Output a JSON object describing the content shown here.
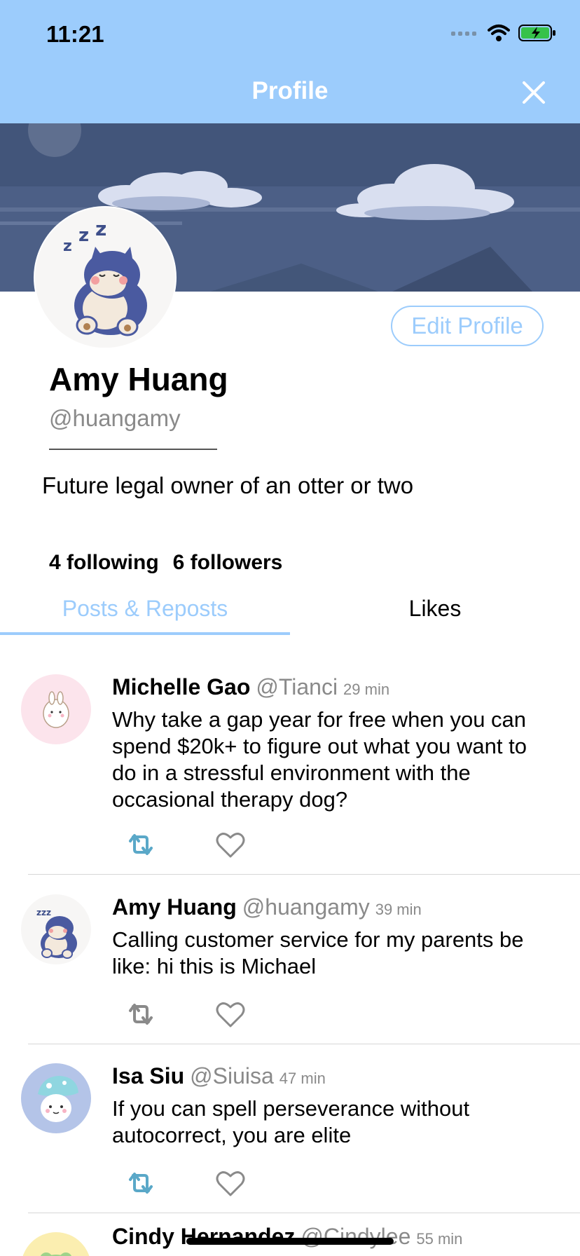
{
  "status": {
    "time": "11:21"
  },
  "header": {
    "title": "Profile"
  },
  "profile": {
    "edit_label": "Edit Profile",
    "name": "Amy Huang",
    "handle": "@huangamy",
    "bio": "Future legal owner of an otter or two",
    "following": "4 following",
    "followers": "6 followers"
  },
  "tabs": [
    {
      "label": "Posts & Reposts",
      "active": true
    },
    {
      "label": "Likes",
      "active": false
    }
  ],
  "posts": [
    {
      "name": "Michelle Gao",
      "handle": "@Tianci",
      "time": "29 min",
      "text": "Why take a gap year for free when you can spend $20k+ to figure out what you want to do in a stressful environment with the occasional therapy dog?",
      "reposted": true
    },
    {
      "name": "Amy Huang",
      "handle": "@huangamy",
      "time": "39 min",
      "text": "Calling customer service for my parents be like: hi this is Michael",
      "reposted": false
    },
    {
      "name": "Isa Siu",
      "handle": "@Siuisa",
      "time": "47 min",
      "text": "If you can spell perseverance without autocorrect, you are elite",
      "reposted": true
    },
    {
      "name": "Cindy Hernandez",
      "handle": "@Cindylee",
      "time": "55 min",
      "text": "",
      "reposted": false
    }
  ],
  "colors": {
    "accent": "#9cccfc",
    "repost_active": "#5aa8c8",
    "icon_inactive": "#8a8a8a"
  }
}
